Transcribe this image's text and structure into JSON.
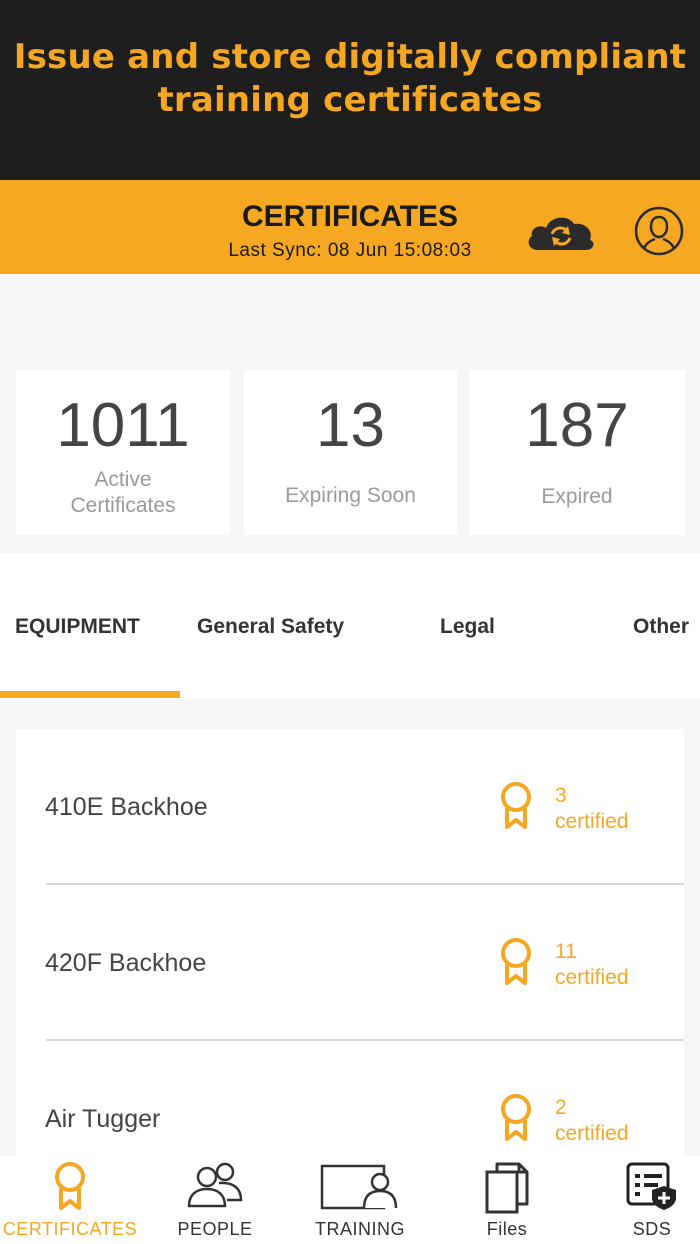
{
  "promo": {
    "text": "Issue and store digitally compliant training certificates"
  },
  "header": {
    "title": "CERTIFICATES",
    "sync_text": "Last Sync: 08 Jun 15:08:03"
  },
  "stats": [
    {
      "value": "1011",
      "label": "Active Certificates"
    },
    {
      "value": "13",
      "label": "Expiring Soon"
    },
    {
      "value": "187",
      "label": "Expired"
    }
  ],
  "tabs": [
    {
      "label": "EQUIPMENT",
      "active": true
    },
    {
      "label": "General Safety",
      "active": false
    },
    {
      "label": "Legal",
      "active": false
    },
    {
      "label": "Other",
      "active": false
    }
  ],
  "equipment": [
    {
      "name": "410E Backhoe",
      "count": "3",
      "certified_label": "certified"
    },
    {
      "name": "420F Backhoe",
      "count": "11",
      "certified_label": "certified"
    },
    {
      "name": "Air Tugger",
      "count": "2",
      "certified_label": "certified"
    }
  ],
  "tabbar": [
    {
      "label": "CERTIFICATES",
      "icon": "award-icon",
      "active": true
    },
    {
      "label": "PEOPLE",
      "icon": "people-icon",
      "active": false
    },
    {
      "label": "TRAINING",
      "icon": "training-icon",
      "active": false
    },
    {
      "label": "Files",
      "icon": "files-icon",
      "active": false
    },
    {
      "label": "SDS",
      "icon": "sds-icon",
      "active": false
    }
  ],
  "colors": {
    "accent": "#f7a823",
    "promo_bg": "#1e1e1e",
    "text_dark": "#1a1a1a"
  }
}
